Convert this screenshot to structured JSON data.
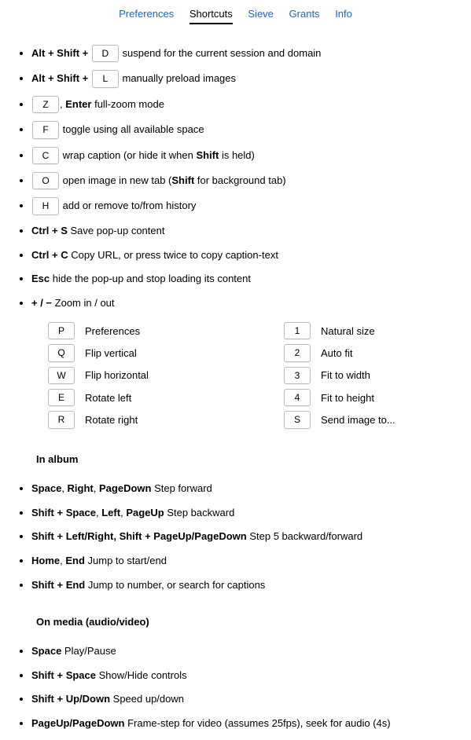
{
  "tabs": [
    {
      "label": "Preferences"
    },
    {
      "label": "Shortcuts"
    },
    {
      "label": "Sieve"
    },
    {
      "label": "Grants"
    },
    {
      "label": "Info"
    }
  ],
  "items": [
    {
      "prefix_bold": "Alt + Shift +",
      "key": "D",
      "desc": "suspend for the current session and domain"
    },
    {
      "prefix_bold": "Alt + Shift +",
      "key": "L",
      "desc": "manually preload images"
    }
  ],
  "z": {
    "key": "Z",
    "sep": ", ",
    "enter": "Enter",
    "desc": " full-zoom mode"
  },
  "f": {
    "key": "F",
    "desc": "toggle using all available space"
  },
  "c": {
    "key": "C",
    "d1": "wrap caption (or hide it when ",
    "shift": "Shift",
    "d2": " is held)"
  },
  "o": {
    "key": "O",
    "d1": "open image in new tab (",
    "shift": "Shift",
    "d2": " for background tab)"
  },
  "h": {
    "key": "H",
    "desc": "add or remove to/from history"
  },
  "ctrls": {
    "b": "Ctrl + S",
    "desc": " Save pop-up content"
  },
  "ctrlc": {
    "b": "Ctrl + C",
    "desc": " Copy URL, or press twice to copy caption-text"
  },
  "esc": {
    "b": "Esc",
    "desc": " hide the pop-up and stop loading its content"
  },
  "zoom": {
    "b": "+ / −",
    "desc": " Zoom in / out"
  },
  "leftcol": [
    {
      "key": "P",
      "label": "Preferences"
    },
    {
      "key": "Q",
      "label": "Flip vertical"
    },
    {
      "key": "W",
      "label": "Flip horizontal"
    },
    {
      "key": "E",
      "label": "Rotate left"
    },
    {
      "key": "R",
      "label": "Rotate right"
    }
  ],
  "rightcol": [
    {
      "key": "1",
      "label": "Natural size"
    },
    {
      "key": "2",
      "label": "Auto fit"
    },
    {
      "key": "3",
      "label": "Fit to width"
    },
    {
      "key": "4",
      "label": "Fit to height"
    },
    {
      "key": "S",
      "label": "Send image to..."
    }
  ],
  "sections": {
    "album": "In album",
    "media": "On media (audio/video)"
  },
  "album": {
    "a1": {
      "k1": "Space",
      "s1": ", ",
      "k2": "Right",
      "s2": ", ",
      "k3": "PageDown",
      "desc": " Step forward"
    },
    "a2": {
      "k1": "Shift + Space",
      "s1": ", ",
      "k2": "Left",
      "s2": ", ",
      "k3": "PageUp",
      "desc": " Step backward"
    },
    "a3": {
      "k1": "Shift + Left/Right, Shift + PageUp/PageDown",
      "desc": " Step 5 backward/forward"
    },
    "a4": {
      "k1": "Home",
      "s1": ", ",
      "k2": "End",
      "desc": " Jump to start/end"
    },
    "a5": {
      "k1": "Shift + End",
      "desc": " Jump to number, or search for captions"
    }
  },
  "media": {
    "m1": {
      "k": "Space",
      "desc": " Play/Pause"
    },
    "m2": {
      "k": "Shift + Space",
      "desc": " Show/Hide controls"
    },
    "m3": {
      "k": "Shift + Up/Down",
      "desc": " Speed up/down"
    },
    "m4": {
      "k": "PageUp/PageDown",
      "desc": " Frame-step for video (assumes 25fps), seek for audio (4s)"
    }
  }
}
